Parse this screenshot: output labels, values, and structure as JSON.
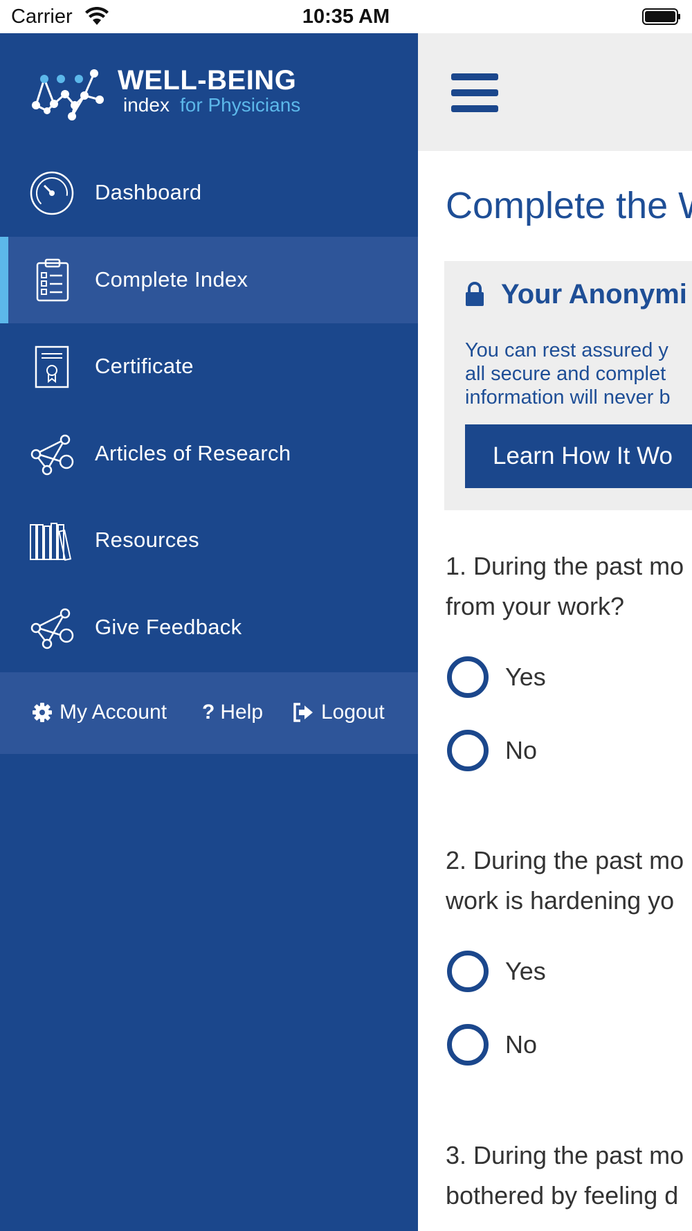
{
  "status_bar": {
    "carrier": "Carrier",
    "time": "10:35 AM"
  },
  "logo": {
    "title": "WELL-BEING",
    "subtitle_prefix": "index",
    "subtitle_suffix": "for Physicians"
  },
  "sidebar": {
    "items": [
      {
        "label": "Dashboard",
        "icon": "dashboard-gauge-icon"
      },
      {
        "label": "Complete Index",
        "icon": "clipboard-checklist-icon",
        "active": true
      },
      {
        "label": "Certificate",
        "icon": "certificate-icon"
      },
      {
        "label": "Articles of Research",
        "icon": "share-icon"
      },
      {
        "label": "Resources",
        "icon": "books-icon"
      },
      {
        "label": "Give Feedback",
        "icon": "share-icon"
      }
    ],
    "account": {
      "my_account": "My Account",
      "help": "Help",
      "logout": "Logout"
    }
  },
  "main": {
    "title": "Complete the W",
    "anonymity": {
      "title": "Your Anonymi",
      "body": "You can rest assured y\nall secure and complet\ninformation will never b",
      "button": "Learn How It Wo"
    },
    "questions": [
      {
        "text": "1. During the past mo\nfrom your work?",
        "options": [
          "Yes",
          "No"
        ]
      },
      {
        "text": "2. During the past mo\nwork is hardening yo",
        "options": [
          "Yes",
          "No"
        ]
      },
      {
        "text": "3. During the past mo\nbothered by feeling d",
        "options": []
      }
    ]
  },
  "colors": {
    "sidebar_bg": "#1b478c",
    "sidebar_active_bg": "#2e5599",
    "accent_light_blue": "#5cb8ea",
    "title_blue": "#1e4e96",
    "topbar_bg": "#eeeeee"
  }
}
